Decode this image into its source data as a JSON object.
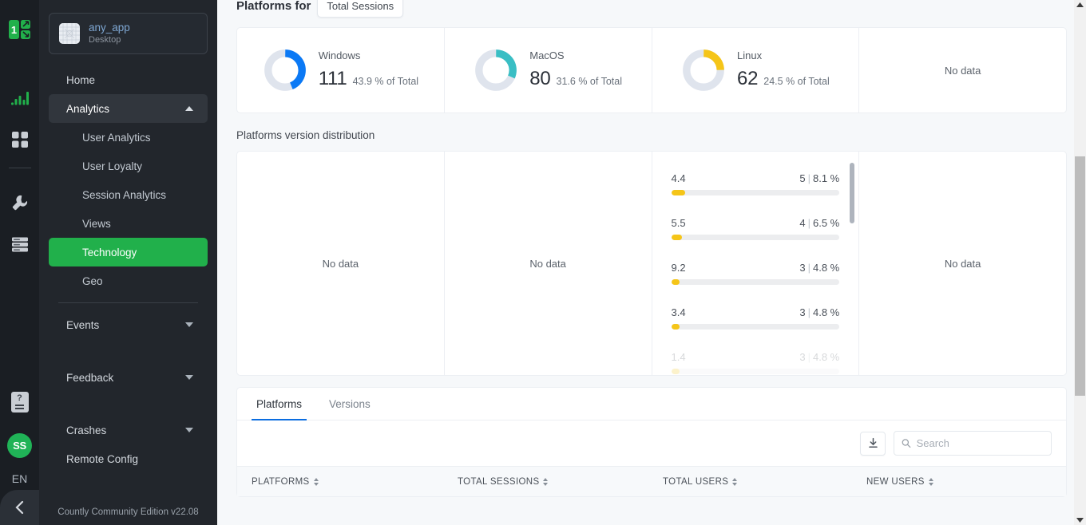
{
  "rail": {
    "logo_icon": "countly-logo-icon",
    "icons": [
      {
        "name": "analytics-bars-icon"
      },
      {
        "name": "apps-grid-icon"
      },
      {
        "name": "wrench-tools-icon"
      },
      {
        "name": "server-stack-icon"
      }
    ],
    "help_label": "?",
    "avatar_initials": "SS",
    "language": "EN",
    "collapse_icon": "chevron-left-icon"
  },
  "sidebar": {
    "app": {
      "name": "any_app",
      "type": "Desktop",
      "thumb_icon": "app-thumbnail-icon"
    },
    "items": [
      {
        "label": "Home",
        "kind": "link"
      },
      {
        "label": "Analytics",
        "kind": "group",
        "expanded": true
      },
      {
        "label": "User Analytics",
        "kind": "sub"
      },
      {
        "label": "User Loyalty",
        "kind": "sub"
      },
      {
        "label": "Session Analytics",
        "kind": "sub"
      },
      {
        "label": "Views",
        "kind": "sub"
      },
      {
        "label": "Technology",
        "kind": "sub",
        "active": true
      },
      {
        "label": "Geo",
        "kind": "sub"
      },
      {
        "label": "Events",
        "kind": "group",
        "expanded": false
      },
      {
        "label": "Feedback",
        "kind": "group",
        "expanded": false
      },
      {
        "label": "Crashes",
        "kind": "group",
        "expanded": false
      },
      {
        "label": "Remote Config",
        "kind": "link"
      }
    ],
    "footer": "Countly Community Edition v22.08"
  },
  "main": {
    "platforms_header": {
      "title": "Platforms for",
      "metric_selector": "Total Sessions"
    },
    "kpi_cells": [
      {
        "label": "Windows",
        "value": "111",
        "pct": "43.9 % of Total",
        "pct_num": 43.9,
        "color": "#0b79f5"
      },
      {
        "label": "MacOS",
        "value": "80",
        "pct": "31.6 % of Total",
        "pct_num": 31.6,
        "color": "#39bec4"
      },
      {
        "label": "Linux",
        "value": "62",
        "pct": "24.5 % of Total",
        "pct_num": 24.5,
        "color": "#f5c518"
      },
      {
        "label": "",
        "value": "",
        "pct": "",
        "empty_text": "No data"
      }
    ],
    "version_section": {
      "title": "Platforms version distribution",
      "panels": [
        {
          "empty_text": "No data",
          "bars": []
        },
        {
          "empty_text": "No data",
          "bars": []
        },
        {
          "empty_text": "",
          "bars": [
            {
              "name": "4.4",
              "count": "5",
              "pct": "8.1 %",
              "pct_num": 8.1
            },
            {
              "name": "5.5",
              "count": "4",
              "pct": "6.5 %",
              "pct_num": 6.5
            },
            {
              "name": "9.2",
              "count": "3",
              "pct": "4.8 %",
              "pct_num": 4.8
            },
            {
              "name": "3.4",
              "count": "3",
              "pct": "4.8 %",
              "pct_num": 4.8
            },
            {
              "name": "1.4",
              "count": "3",
              "pct": "4.8 %",
              "pct_num": 4.8
            }
          ]
        },
        {
          "empty_text": "No data",
          "bars": []
        }
      ]
    },
    "table_section": {
      "tabs": [
        {
          "label": "Platforms",
          "active": true
        },
        {
          "label": "Versions",
          "active": false
        }
      ],
      "export_icon": "download-icon",
      "search": {
        "placeholder": "Search",
        "value": "",
        "icon": "search-icon"
      },
      "columns": [
        "PLATFORMS",
        "TOTAL SESSIONS",
        "TOTAL USERS",
        "NEW USERS"
      ],
      "rows": []
    }
  },
  "chart_data": [
    {
      "type": "pie",
      "title": "Platforms for Total Sessions",
      "categories": [
        "Windows",
        "MacOS",
        "Linux"
      ],
      "values": [
        111,
        80,
        62
      ],
      "percent": [
        43.9,
        31.6,
        24.5
      ],
      "colors": [
        "#0b79f5",
        "#39bec4",
        "#f5c518"
      ],
      "legend": "inline-labels",
      "ylabel": "",
      "xlabel": ""
    },
    {
      "type": "bar",
      "title": "Platforms version distribution",
      "orientation": "horizontal",
      "categories": [
        "4.4",
        "5.5",
        "9.2",
        "3.4",
        "1.4"
      ],
      "values": [
        5,
        4,
        3,
        3,
        3
      ],
      "percent": [
        8.1,
        6.5,
        4.8,
        4.8,
        4.8
      ],
      "color": "#f5c518",
      "xlim": [
        0,
        62
      ],
      "grid": false,
      "ylabel": "",
      "xlabel": ""
    }
  ],
  "theme": {
    "accent_green": "#21b04b",
    "accent_blue": "#0b6de0",
    "sidebar_bg": "#22262c",
    "rail_bg": "#1a1e23",
    "page_bg": "#f6f8fa"
  }
}
